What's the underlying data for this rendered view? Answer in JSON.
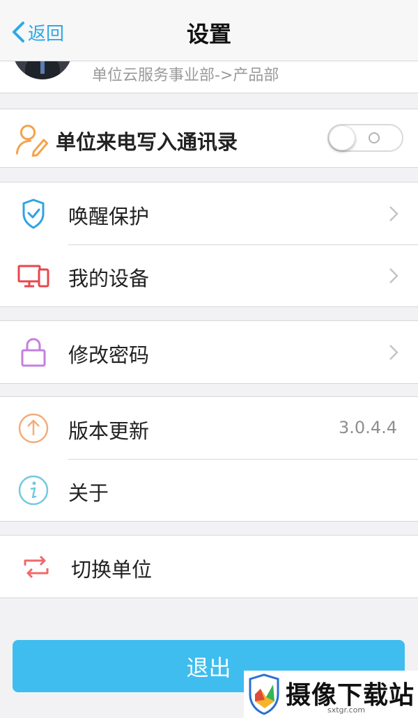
{
  "nav": {
    "back_label": "返回",
    "title": "设置"
  },
  "profile": {
    "department": "单位云服务事业部->产品部"
  },
  "call_toggle": {
    "label": "单位来电写入通讯录",
    "state": "off"
  },
  "groups": [
    {
      "rows": [
        {
          "label": "唤醒保护",
          "icon": "shield-check-icon"
        },
        {
          "label": "我的设备",
          "icon": "devices-icon"
        }
      ]
    },
    {
      "rows": [
        {
          "label": "修改密码",
          "icon": "lock-icon"
        }
      ]
    },
    {
      "rows": [
        {
          "label": "版本更新",
          "icon": "upload-arrow-icon",
          "value": "3.0.4.4"
        },
        {
          "label": "关于",
          "icon": "info-icon"
        }
      ]
    },
    {
      "rows": [
        {
          "label": "切换单位",
          "icon": "switch-arrows-icon"
        }
      ]
    }
  ],
  "logout_label": "退出",
  "watermark": {
    "text": "摄像下载站",
    "url": "sxtgr.com"
  },
  "colors": {
    "accent": "#3fbdef",
    "nav_blue": "#2ea8e6",
    "background": "#f2f2f4"
  }
}
